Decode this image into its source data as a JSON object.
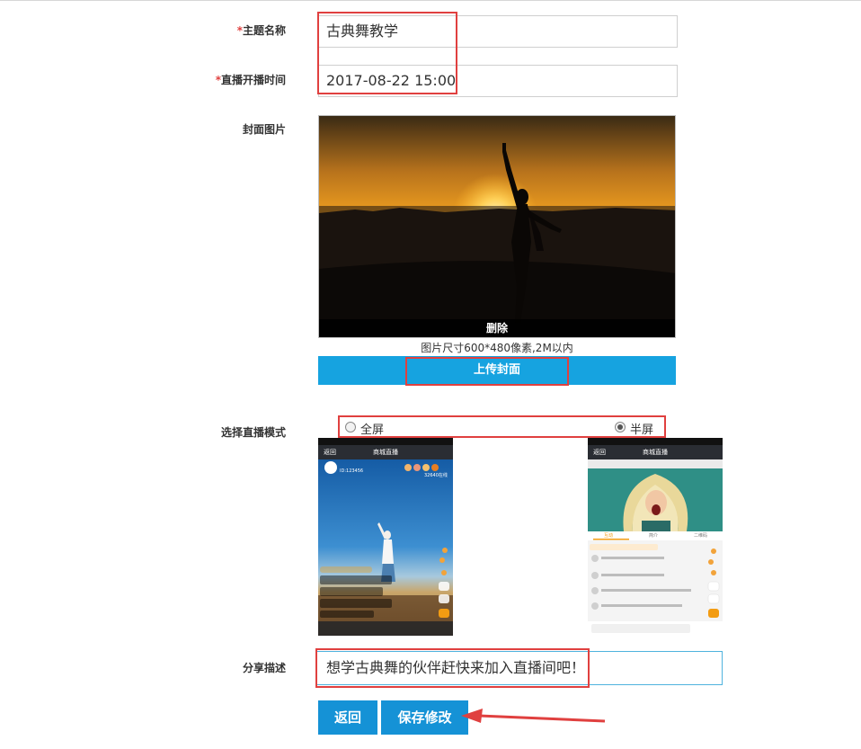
{
  "form": {
    "topic": {
      "label": "主题名称",
      "value": "古典舞教学"
    },
    "start_time": {
      "label": "直播开播时间",
      "value": "2017-08-22 15:00"
    },
    "cover": {
      "label": "封面图片",
      "delete_label": "删除",
      "hint": "图片尺寸600*480像素,2M以内",
      "upload_label": "上传封面"
    },
    "mode": {
      "label": "选择直播模式",
      "options": [
        {
          "label": "全屏",
          "checked": false
        },
        {
          "label": "半屏",
          "checked": true
        }
      ]
    },
    "share": {
      "label": "分享描述",
      "value": "想学古典舞的伙伴赶快来加入直播间吧！"
    },
    "buttons": {
      "back": "返回",
      "save": "保存修改"
    }
  },
  "preview_full": {
    "nav_back": "返回",
    "nav_title": "商城直播",
    "user_id": "ID:123456",
    "viewers": "32640在线"
  },
  "preview_half": {
    "nav_back": "返回",
    "nav_title": "商城直播",
    "tabs": [
      "互动",
      "简介",
      "二维码"
    ]
  },
  "required_mark": "*",
  "colors": {
    "accent": "#16a3e0",
    "highlight": "#e0403f",
    "button": "#1592d6"
  }
}
